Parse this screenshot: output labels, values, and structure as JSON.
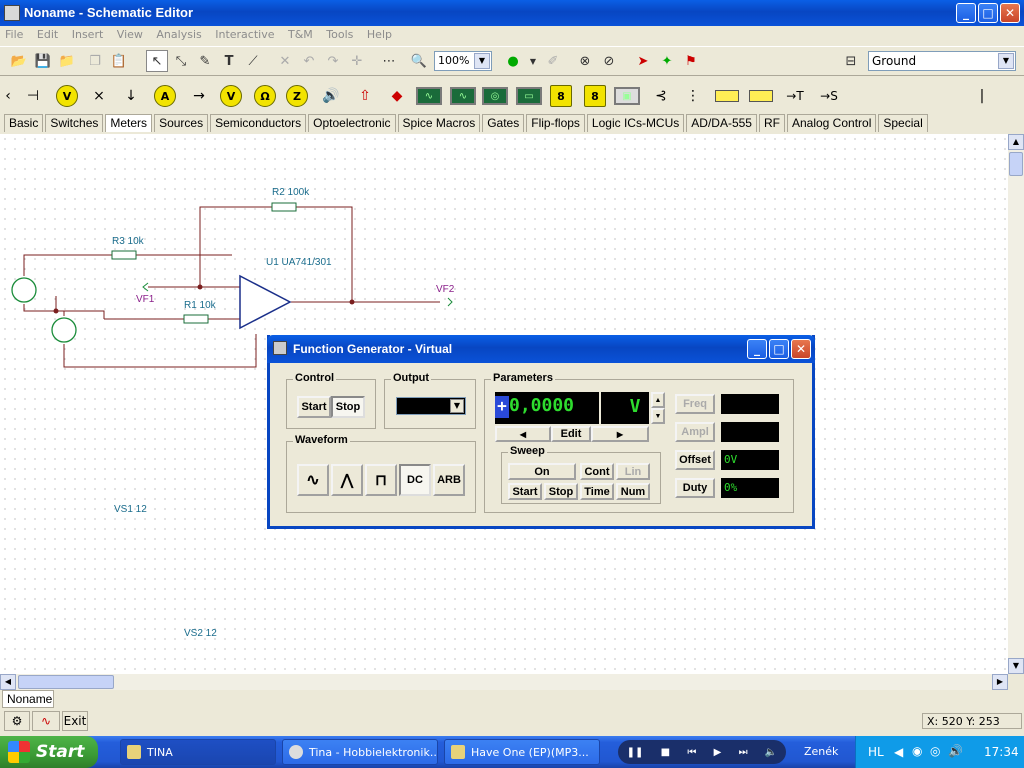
{
  "window": {
    "title": "Noname - Schematic Editor",
    "min": "_",
    "max": "□",
    "close": "✕"
  },
  "menu": [
    "File",
    "Edit",
    "Insert",
    "View",
    "Analysis",
    "Interactive",
    "T&M",
    "Tools",
    "Help"
  ],
  "toolbar": {
    "zoom": "100%",
    "ground": "Ground",
    "dropdown_arrow": "▼"
  },
  "tabs": [
    "Basic",
    "Switches",
    "Meters",
    "Sources",
    "Semiconductors",
    "Optoelectronic",
    "Spice Macros",
    "Gates",
    "Flip-flops",
    "Logic ICs-MCUs",
    "AD/DA-555",
    "RF",
    "Analog Control",
    "Special"
  ],
  "active_tab": "Meters",
  "schematic": {
    "r2": "R2 100k",
    "r3": "R3 10k",
    "r1": "R1 10k",
    "u1": "U1 UA741/301",
    "vf1": "VF1",
    "vf2": "VF2",
    "vs1": "VS1 12",
    "vs2": "VS2 12"
  },
  "doc_tab": "Noname",
  "status": {
    "exit": "Exit",
    "coords": "X: 520  Y: 253"
  },
  "function_generator": {
    "title": "Function Generator - Virtual",
    "control": {
      "label": "Control",
      "start": "Start",
      "stop": "Stop"
    },
    "output": {
      "label": "Output"
    },
    "waveform": {
      "label": "Waveform",
      "dc": "DC",
      "arb": "ARB"
    },
    "parameters": {
      "label": "Parameters",
      "sign": "+",
      "value": "0,0000",
      "unit": "V",
      "edit": "Edit",
      "freq": "Freq",
      "ampl": "Ampl",
      "offset": "Offset",
      "offset_value": "0V",
      "duty": "Duty",
      "duty_value": "0%"
    },
    "sweep": {
      "label": "Sweep",
      "on": "On",
      "cont": "Cont",
      "lin": "Lin",
      "start": "Start",
      "stop": "Stop",
      "time": "Time",
      "num": "Num"
    }
  },
  "taskbar": {
    "start": "Start",
    "tasks": [
      "TINA",
      "Tina - Hobbielektronik...",
      "Have One (EP)(MP3..."
    ],
    "tray_label": "Zenék",
    "lang": "HL",
    "clock": "17:34"
  }
}
